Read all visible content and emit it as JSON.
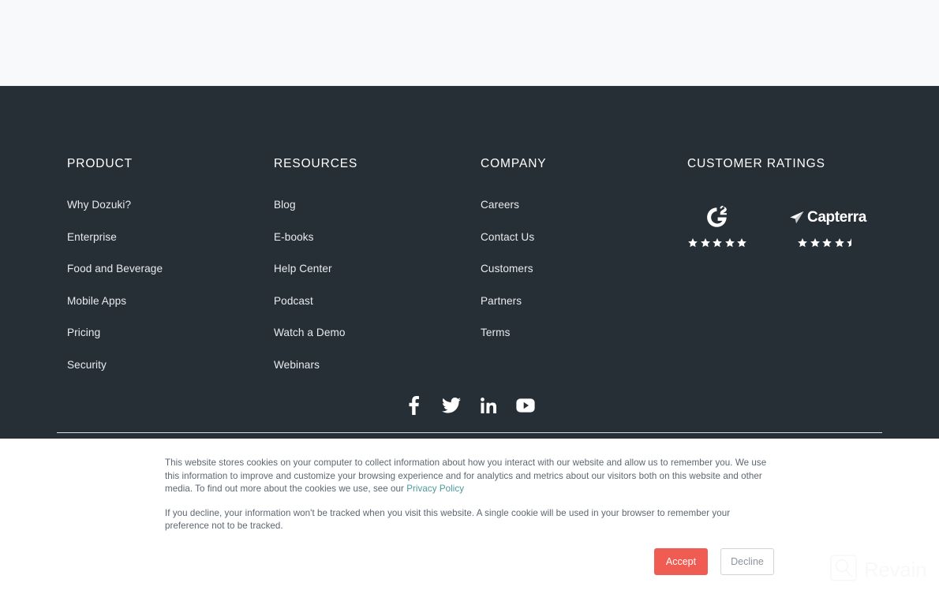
{
  "footer": {
    "columns": [
      {
        "heading": "PRODUCT",
        "links": [
          "Why Dozuki?",
          "Enterprise",
          "Food and Beverage",
          "Mobile Apps",
          "Pricing",
          "Security"
        ]
      },
      {
        "heading": "RESOURCES",
        "links": [
          "Blog",
          "E-books",
          "Help Center",
          "Podcast",
          "Watch a Demo",
          "Webinars"
        ]
      },
      {
        "heading": "COMPANY",
        "links": [
          "Careers",
          "Contact Us",
          "Customers",
          "Partners",
          "Terms"
        ]
      }
    ],
    "ratings": {
      "heading": "CUSTOMER RATINGS",
      "badges": [
        {
          "name": "G2",
          "logo_icon": "g2-logo-icon",
          "stars": 5,
          "max_stars": 5
        },
        {
          "name": "Capterra",
          "logo_icon": "capterra-logo-icon",
          "logo_text": "Capterra",
          "stars": 4.5,
          "max_stars": 5
        }
      ]
    },
    "social": [
      {
        "name": "Facebook",
        "icon": "facebook-icon"
      },
      {
        "name": "Twitter",
        "icon": "twitter-icon"
      },
      {
        "name": "LinkedIn",
        "icon": "linkedin-icon"
      },
      {
        "name": "YouTube",
        "icon": "youtube-icon"
      }
    ]
  },
  "cookie_banner": {
    "paragraph_1_before_link": "This website stores cookies on your computer to collect information about how you interact with our website and allow us to remember you. We use this information to improve and customize your browsing experience and for analytics and metrics about our visitors both on this website and other media. To find out more about the cookies we use, see our ",
    "privacy_link": "Privacy Policy",
    "paragraph_2": "If you decline, your information won't be tracked when you visit this website. A single cookie will be used in your browser to remember your preference not to be tracked.",
    "accept_label": "Accept",
    "decline_label": "Decline"
  },
  "watermark": {
    "text": "Revain",
    "icon": "revain-logo-icon"
  },
  "colors": {
    "footer_bg": "#262e36",
    "page_top_bg": "#f7f9fa",
    "accept_bg": "#f05b52",
    "link_teal": "#4a9a9d",
    "link_light": "#e9ecef"
  }
}
